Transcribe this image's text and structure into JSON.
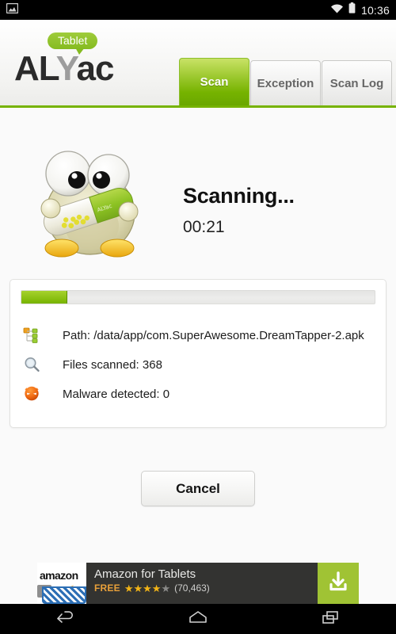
{
  "statusbar": {
    "left_icon": "image-icon",
    "wifi_icon": "wifi-icon",
    "battery_icon": "battery-icon",
    "clock": "10:36"
  },
  "header": {
    "logo_badge": "Tablet",
    "logo_part1": "AL",
    "logo_part2": "Y",
    "logo_part3": "ac",
    "tabs": [
      {
        "label": "Scan",
        "active": true
      },
      {
        "label": "Exception",
        "active": false
      },
      {
        "label": "Scan Log",
        "active": false
      }
    ]
  },
  "main": {
    "mascot_icon": "alyac-mascot-icon",
    "status_title": "Scanning...",
    "elapsed_time": "00:21",
    "progress_percent": 13,
    "rows": [
      {
        "icon": "folder-tree-icon",
        "text": "Path: /data/app/com.SuperAwesome.DreamTapper-2.apk"
      },
      {
        "icon": "magnifier-icon",
        "text": "Files scanned: 368"
      },
      {
        "icon": "malware-devil-icon",
        "text": "Malware detected: 0"
      }
    ],
    "cancel_label": "Cancel"
  },
  "ad": {
    "brand": "amazon",
    "title": "Amazon for Tablets",
    "price": "FREE",
    "stars_filled": 4,
    "stars_total": 5,
    "rating_count": "(70,463)",
    "cta_icon": "download-icon"
  },
  "navbar": {
    "back_icon": "back-icon",
    "home_icon": "home-icon",
    "recents_icon": "recents-icon"
  },
  "colors": {
    "accent_green": "#76b300",
    "accent_green_light": "#c9e266",
    "ad_cta_green": "#a0c334",
    "malware_orange": "#e8631a",
    "star_gold": "#f2b417"
  }
}
